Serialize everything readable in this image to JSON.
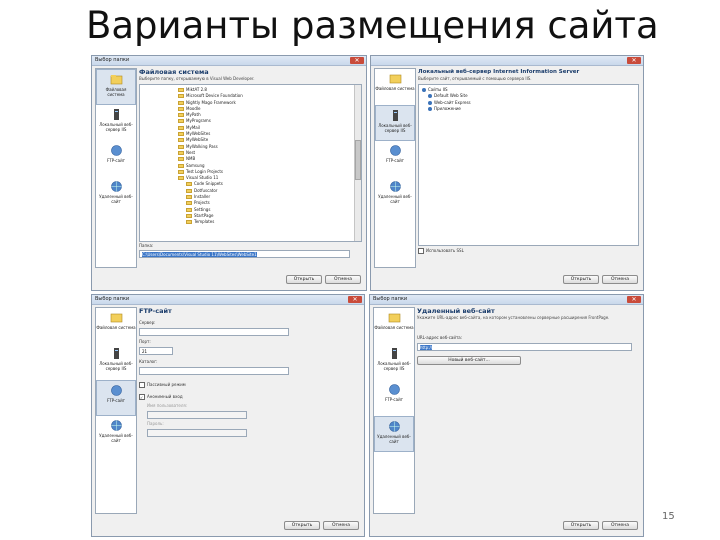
{
  "slide": {
    "title": "Варианты размещения сайта",
    "page_number": "15"
  },
  "nav": {
    "file_system": "Файловая система",
    "local_iis": "Локальный веб-сервер IIS",
    "ftp": "FTP-сайт",
    "remote": "Удаленный веб-сайт"
  },
  "dialogs": {
    "d1": {
      "title": "Выбор папки",
      "heading": "Файловая система",
      "subtitle": "Выберите папку, открываемую в Visual Web Developer.",
      "tree": [
        "MiktAT 2.8",
        "Microsoft Device Foundation",
        "Nightly Mago Framework",
        "Moodle",
        "MyPath",
        "MyPrograms",
        "MyMail",
        "MyWebSites",
        "MyWebSite",
        "MyWalking Pass",
        "Nest",
        "NMB",
        "Samsung",
        "Test Login Projects",
        "Visual Studio 11",
        "Code Snippets",
        "Dotfuscator",
        "Installer",
        "Projects",
        "Settings",
        "StartPage",
        "Templates"
      ],
      "path_label": "Папка:",
      "path_value": "C:\\Users\\Documents\\Visual Studio 11\\WebSites\\WebSite1",
      "open": "Открыть",
      "cancel": "Отмена"
    },
    "d2": {
      "heading": "Локальный веб-сервер Internet Information Server",
      "subtitle": "Выберите сайт, открываемый с помощью сервера IIS.",
      "items": [
        "Сайты IIS",
        "Default Web Site",
        "Web-сайт Express",
        "Приложение"
      ],
      "ssl_label": "Использовать SSL",
      "open": "Открыть",
      "cancel": "Отмена"
    },
    "d3": {
      "title": "Выбор папки",
      "heading": "FTP-сайт",
      "server_label": "Сервер:",
      "port_label": "Порт:",
      "port_value": "21",
      "dir_label": "Каталог:",
      "passive_label": "Пассивный режим",
      "anon_label": "Анонимный вход",
      "user_label": "Имя пользователя:",
      "pass_label": "Пароль:",
      "open": "Открыть",
      "cancel": "Отмена"
    },
    "d4": {
      "title": "Выбор папки",
      "heading": "Удаленный веб-сайт",
      "subtitle": "Укажите URL-адрес веб-сайта, на котором установлены серверные расширения FrontPage.",
      "url_label": "URL-адрес веб-сайта:",
      "url_value": "http://",
      "new_site": "Новый веб-сайт...",
      "open": "Открыть",
      "cancel": "Отмена"
    }
  },
  "colors": {
    "accent": "#1a3c6b",
    "selection": "#3a76c8",
    "folder": "#f2cf5b"
  }
}
